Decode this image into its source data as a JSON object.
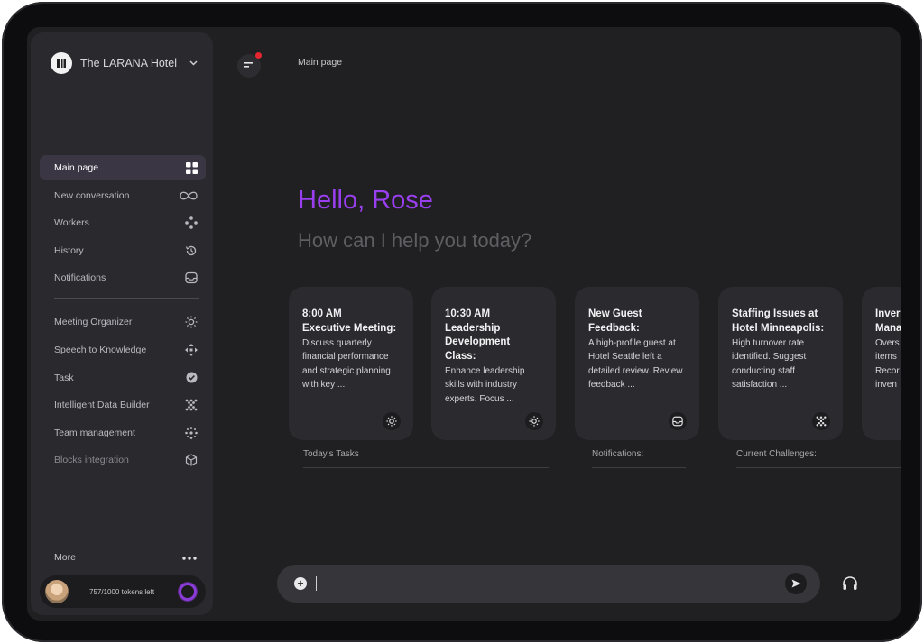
{
  "hotel": {
    "name": "The LARANA Hotel",
    "logo_icon": "hotel-logo-icon",
    "chevron_icon": "chevron-down-icon"
  },
  "sidebar": {
    "items": [
      {
        "label": "Main page",
        "icon": "grid-icon",
        "active": true
      },
      {
        "label": "New conversation",
        "icon": "infinity-icon"
      },
      {
        "label": "Workers",
        "icon": "workers-icon"
      },
      {
        "label": "History",
        "icon": "history-icon"
      },
      {
        "label": "Notifications",
        "icon": "inbox-icon"
      },
      {
        "label": "Meeting Organizer",
        "icon": "sun-icon"
      },
      {
        "label": "Speech to Knowledge",
        "icon": "move-icon"
      },
      {
        "label": "Task",
        "icon": "check-circle-icon"
      },
      {
        "label": "Intelligent Data Builder",
        "icon": "data-builder-icon"
      },
      {
        "label": "Team management",
        "icon": "team-icon"
      },
      {
        "label": "Blocks integration",
        "icon": "cube-icon"
      }
    ],
    "more_label": "More",
    "tokens_text": "757/1000 tokens left",
    "tokens_fraction": 0.757
  },
  "header": {
    "breadcrumb": "Main page"
  },
  "greeting": {
    "hello": "Hello, Rose",
    "prompt": "How can I help you today?"
  },
  "cards": [
    {
      "title": "8:00 AM\nExecutive Meeting:",
      "body": "Discuss quarterly financial performance and strategic planning with key ...",
      "icon": "sun-icon"
    },
    {
      "title": "10:30 AM\nLeadership Development Class:",
      "body": "Enhance leadership skills with industry experts. Focus ...",
      "icon": "sun-icon"
    },
    {
      "title": "New Guest Feedback:",
      "body": "A high-profile guest at Hotel Seattle left a detailed review. Review feedback ...",
      "icon": "inbox-icon"
    },
    {
      "title": "Staffing Issues at Hotel Minneapolis:",
      "body": "High turnover rate identified. Suggest conducting staff satisfaction ...",
      "icon": "data-builder-icon"
    },
    {
      "title": "Inver Mana",
      "body": "Overs items Recor inven",
      "icon": ""
    }
  ],
  "sections": {
    "tasks": "Today's Tasks",
    "notifications": "Notifications:",
    "challenges": "Current Challenges:"
  },
  "chat": {
    "value": "",
    "placeholder": ""
  },
  "colors": {
    "accent": "#9a3ff0",
    "sidebar_active": "#3a3644",
    "notification_dot": "#e3262f"
  }
}
